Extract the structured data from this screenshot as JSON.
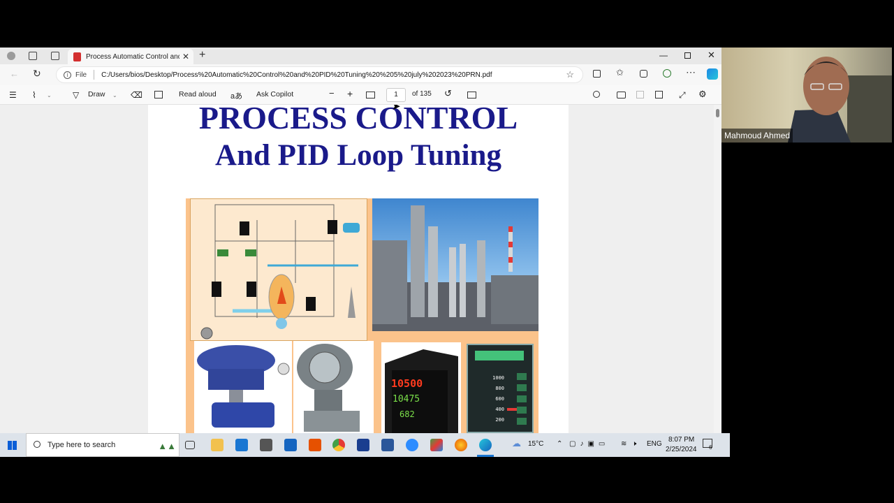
{
  "browser": {
    "tab_title": "Process Automatic Control and P",
    "address_prefix": "File",
    "address_url": "C:/Users/bios/Desktop/Process%20Automatic%20Control%20and%20PID%20Tuning%20%205%20july%202023%20PRN.pdf"
  },
  "pdf_toolbar": {
    "draw_label": "Draw",
    "read_aloud_label": "Read aloud",
    "ask_copilot_label": "Ask Copilot",
    "page_current": "1",
    "page_total": "of 135"
  },
  "pdf_page": {
    "title_line1": "PROCESS CONTROL",
    "title_line2": "And PID Loop Tuning",
    "controller1_display_top": "10500",
    "controller1_display_mid": "10475",
    "controller1_display_bot": "682",
    "controller2_scale": [
      "1000",
      "800",
      "600",
      "400",
      "200"
    ]
  },
  "taskbar": {
    "search_placeholder": "Type here to search",
    "weather": "15°C",
    "language": "ENG",
    "time": "8:07 PM",
    "date": "2/25/2024",
    "notifications_count": "6"
  },
  "video": {
    "participant_name": "Mahmoud Ahmed"
  },
  "colors": {
    "title_blue": "#1a1a8a",
    "pdf_red": "#d32f2f",
    "collage_orange": "#fbc38b"
  }
}
